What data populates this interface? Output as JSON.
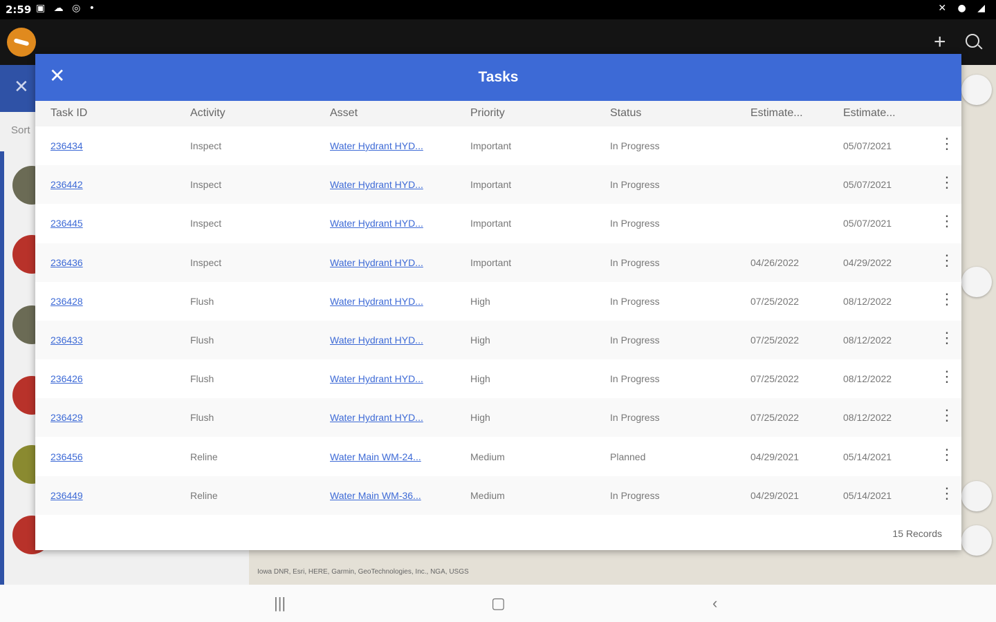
{
  "statusbar": {
    "time": "2:59"
  },
  "background_panel": {
    "sort_label": "Sort"
  },
  "map": {
    "attribution": "Iowa DNR, Esri, HERE, Garmin, GeoTechnologies, Inc., NGA, USGS"
  },
  "modal": {
    "title": "Tasks",
    "columns": [
      "Task ID",
      "Activity",
      "Asset",
      "Priority",
      "Status",
      "Estimate...",
      "Estimate..."
    ],
    "rows": [
      {
        "id": "236434",
        "activity": "Inspect",
        "asset": "Water Hydrant HYD...",
        "priority": "Important",
        "status": "In Progress",
        "est_start": "",
        "est_end": "05/07/2021"
      },
      {
        "id": "236442",
        "activity": "Inspect",
        "asset": "Water Hydrant HYD...",
        "priority": "Important",
        "status": "In Progress",
        "est_start": "",
        "est_end": "05/07/2021"
      },
      {
        "id": "236445",
        "activity": "Inspect",
        "asset": "Water Hydrant HYD...",
        "priority": "Important",
        "status": "In Progress",
        "est_start": "",
        "est_end": "05/07/2021"
      },
      {
        "id": "236436",
        "activity": "Inspect",
        "asset": "Water Hydrant HYD...",
        "priority": "Important",
        "status": "In Progress",
        "est_start": "04/26/2022",
        "est_end": "04/29/2022"
      },
      {
        "id": "236428",
        "activity": "Flush",
        "asset": "Water Hydrant HYD...",
        "priority": "High",
        "status": "In Progress",
        "est_start": "07/25/2022",
        "est_end": "08/12/2022"
      },
      {
        "id": "236433",
        "activity": "Flush",
        "asset": "Water Hydrant HYD...",
        "priority": "High",
        "status": "In Progress",
        "est_start": "07/25/2022",
        "est_end": "08/12/2022"
      },
      {
        "id": "236426",
        "activity": "Flush",
        "asset": "Water Hydrant HYD...",
        "priority": "High",
        "status": "In Progress",
        "est_start": "07/25/2022",
        "est_end": "08/12/2022"
      },
      {
        "id": "236429",
        "activity": "Flush",
        "asset": "Water Hydrant HYD...",
        "priority": "High",
        "status": "In Progress",
        "est_start": "07/25/2022",
        "est_end": "08/12/2022"
      },
      {
        "id": "236456",
        "activity": "Reline",
        "asset": "Water Main WM-24...",
        "priority": "Medium",
        "status": "Planned",
        "est_start": "04/29/2021",
        "est_end": "05/14/2021"
      },
      {
        "id": "236449",
        "activity": "Reline",
        "asset": "Water Main WM-36...",
        "priority": "Medium",
        "status": "In Progress",
        "est_start": "04/29/2021",
        "est_end": "05/14/2021"
      }
    ],
    "records_label": "15 Records"
  }
}
